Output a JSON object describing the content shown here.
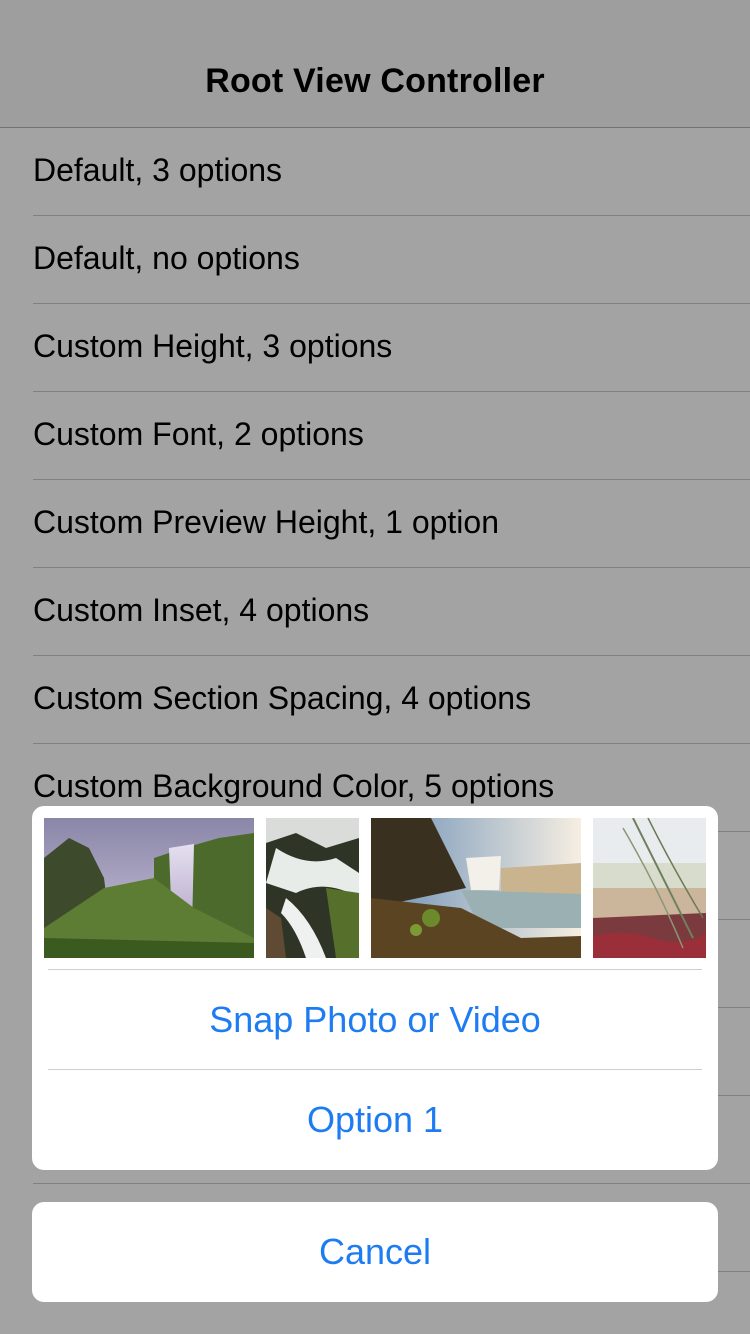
{
  "nav": {
    "title": "Root View Controller"
  },
  "table": {
    "rows": [
      "Default, 3 options",
      "Default, no options",
      "Custom Height, 3 options",
      "Custom Font, 2 options",
      "Custom Preview Height, 1 option",
      "Custom Inset, 4 options",
      "Custom Section Spacing, 4 options",
      "Custom Background Color, 5 options",
      "",
      "",
      "",
      "",
      ""
    ]
  },
  "action_sheet": {
    "photos": [
      "waterfall-valley-photo",
      "waterfall-rocks-photo",
      "waterfall-coast-photo",
      "beach-grass-photo"
    ],
    "buttons": {
      "snap": "Snap Photo or Video",
      "option1": "Option 1"
    },
    "cancel": "Cancel"
  },
  "colors": {
    "accent": "#1e7cf2",
    "nav_bg": "#f7f7f7",
    "separator": "#c8c7cc"
  }
}
